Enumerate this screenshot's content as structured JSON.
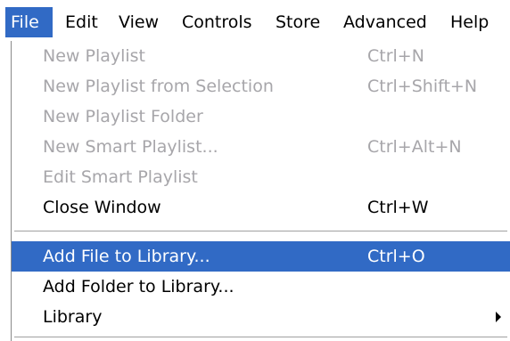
{
  "menubar": {
    "items": [
      {
        "label": "File",
        "active": true
      },
      {
        "label": "Edit"
      },
      {
        "label": "View"
      },
      {
        "label": "Controls"
      },
      {
        "label": "Store"
      },
      {
        "label": "Advanced"
      },
      {
        "label": "Help"
      }
    ]
  },
  "file_menu": {
    "items": [
      {
        "label": "New Playlist",
        "shortcut": "Ctrl+N",
        "enabled": false
      },
      {
        "label": "New Playlist from Selection",
        "shortcut": "Ctrl+Shift+N",
        "enabled": false
      },
      {
        "label": "New Playlist Folder",
        "shortcut": "",
        "enabled": false
      },
      {
        "label": "New Smart Playlist...",
        "shortcut": "Ctrl+Alt+N",
        "enabled": false
      },
      {
        "label": "Edit Smart Playlist",
        "shortcut": "",
        "enabled": false
      },
      {
        "label": "Close Window",
        "shortcut": "Ctrl+W",
        "enabled": true
      },
      {
        "label": "Add File to Library...",
        "shortcut": "Ctrl+O",
        "enabled": true,
        "highlighted": true
      },
      {
        "label": "Add Folder to Library...",
        "shortcut": "",
        "enabled": true
      },
      {
        "label": "Library",
        "shortcut": "",
        "enabled": true,
        "has_submenu": true,
        "submenu_icon": "chevron-right-icon"
      }
    ]
  },
  "colors": {
    "highlight": "#316ac5",
    "disabled_text": "#a7a6aa"
  }
}
